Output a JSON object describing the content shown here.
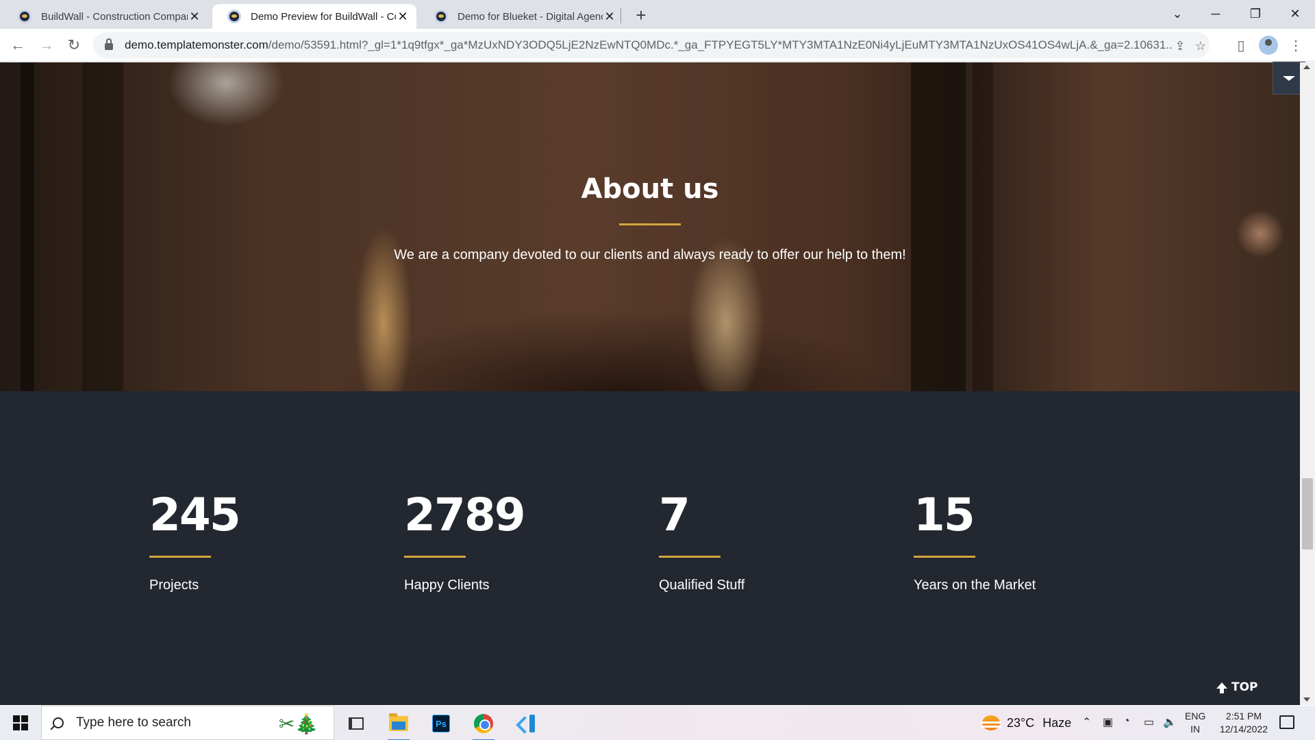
{
  "browser": {
    "tabs": [
      {
        "title": "BuildWall - Construction Company",
        "active": false
      },
      {
        "title": "Demo Preview for BuildWall - Construction",
        "active": true
      },
      {
        "title": "Demo for Blueket - Digital Agency",
        "active": false
      }
    ],
    "url_host": "demo.templatemonster.com",
    "url_path": "/demo/53591.html?_gl=1*1q9tfgx*_ga*MzUxNDY3ODQ5LjE2NzEwNTQ0MDc.*_ga_FTPYEGT5LY*MTY3MTA1NzE0Ni4yLjEuMTY3MTA1NzUxOS41OS4wLjA.&_ga=2.10631..."
  },
  "about": {
    "title": "About us",
    "text": "We are a company devoted to our clients and always ready to offer our help to them!"
  },
  "stats": [
    {
      "value": "245",
      "label": "Projects"
    },
    {
      "value": "2789",
      "label": "Happy Clients"
    },
    {
      "value": "7",
      "label": "Qualified Stuff"
    },
    {
      "value": "15",
      "label": "Years on the Market"
    }
  ],
  "top_button": "TOP",
  "taskbar": {
    "search_placeholder": "Type here to search",
    "ps_label": "Ps",
    "weather": {
      "temp": "23°C",
      "condition": "Haze"
    },
    "lang": {
      "line1": "ENG",
      "line2": "IN"
    },
    "clock": {
      "time": "2:51 PM",
      "date": "12/14/2022"
    }
  },
  "colors": {
    "accent": "#d4a53f",
    "stats_bg": "#222730"
  }
}
